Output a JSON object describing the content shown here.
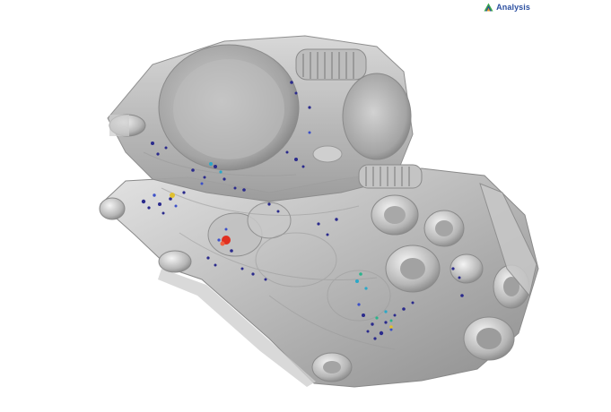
{
  "brand": {
    "label": "Analysis",
    "icon": "triangle-logo-icon",
    "colors": {
      "primary": "#2b4fa0",
      "accent_green": "#3aa848",
      "accent_orange": "#f0a020"
    }
  },
  "viewer": {
    "background": "#ffffff",
    "model_color": "#b8b8b8",
    "indication_colors": [
      "#2a2a8c",
      "#3c50c8",
      "#2aa8c8",
      "#2ab48c",
      "#e0c030",
      "#e03020"
    ]
  }
}
